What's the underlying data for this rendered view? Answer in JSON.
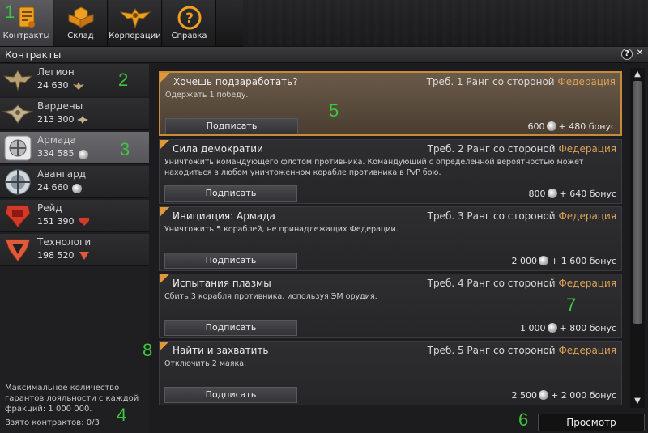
{
  "nav": {
    "tabs": [
      {
        "label": "Контракты",
        "icon": "contract-icon",
        "active": true
      },
      {
        "label": "Склад",
        "icon": "storage-icon",
        "active": false
      },
      {
        "label": "Корпорации",
        "icon": "corporation-icon",
        "active": false
      },
      {
        "label": "Справка",
        "icon": "help-icon",
        "active": false
      }
    ]
  },
  "window": {
    "title": "Контракты",
    "help_label": "?",
    "close_label": "✕"
  },
  "factions": [
    {
      "name": "Легион",
      "value": "24 630",
      "icon": "legion-icon",
      "active": false
    },
    {
      "name": "Вардены",
      "value": "213 300",
      "icon": "wardens-icon",
      "active": false
    },
    {
      "name": "Армада",
      "value": "334 585",
      "icon": "armada-icon",
      "active": true
    },
    {
      "name": "Авангард",
      "value": "24 660",
      "icon": "vanguard-icon",
      "active": false
    },
    {
      "name": "Рейд",
      "value": "151 390",
      "icon": "raid-icon",
      "active": false
    },
    {
      "name": "Технологи",
      "value": "198 520",
      "icon": "technologists-icon",
      "active": false
    }
  ],
  "sidebar_info": {
    "loyalty_text": "Максимальное количество гарантов лояльности с каждой фракций: 1 000 000.",
    "contracts_taken": "Взято контрактов: 0/3"
  },
  "contracts": [
    {
      "title": "Хочешь подзаработать?",
      "req_prefix": "Треб. 1 Ранг со стороной",
      "faction": "Федерация",
      "description": "Одержать 1 победу.",
      "sign_label": "Подписать",
      "reward": "600",
      "bonus": "+ 480 бонус",
      "selected": true
    },
    {
      "title": "Сила демократии",
      "req_prefix": "Треб. 2 Ранг со стороной",
      "faction": "Федерация",
      "description": "Уничтожить командующего флотом противника. Командующий с определенной вероятностью может находиться в любом уничтоженном корабле противника в PvP бою.",
      "sign_label": "Подписать",
      "reward": "800",
      "bonus": "+ 640 бонус",
      "selected": false
    },
    {
      "title": "Инициация: Армада",
      "req_prefix": "Треб. 3 Ранг со стороной",
      "faction": "Федерация",
      "description": "Уничтожить 5 кораблей, не принадлежащих Федерации.",
      "sign_label": "Подписать",
      "reward": "2 000",
      "bonus": "+ 1 600 бонус",
      "selected": false
    },
    {
      "title": "Испытания плазмы",
      "req_prefix": "Треб. 4 Ранг со стороной",
      "faction": "Федерация",
      "description": "Сбить 3 корабля противника, используя ЭМ орудия.",
      "sign_label": "Подписать",
      "reward": "1 000",
      "bonus": "+ 800 бонус",
      "selected": false
    },
    {
      "title": "Найти и захватить",
      "req_prefix": "Треб. 5 Ранг со стороной",
      "faction": "Федерация",
      "description": "Отключить 2 маяка.",
      "sign_label": "Подписать",
      "reward": "2 500",
      "bonus": "+ 2 000 бонус",
      "selected": false
    }
  ],
  "view_button": "Просмотр",
  "markers": [
    "1",
    "2",
    "3",
    "4",
    "5",
    "6",
    "7",
    "8"
  ],
  "colors": {
    "accent": "#d9a255",
    "selected_border": "#c98a3c",
    "marker": "#3ec63e"
  }
}
